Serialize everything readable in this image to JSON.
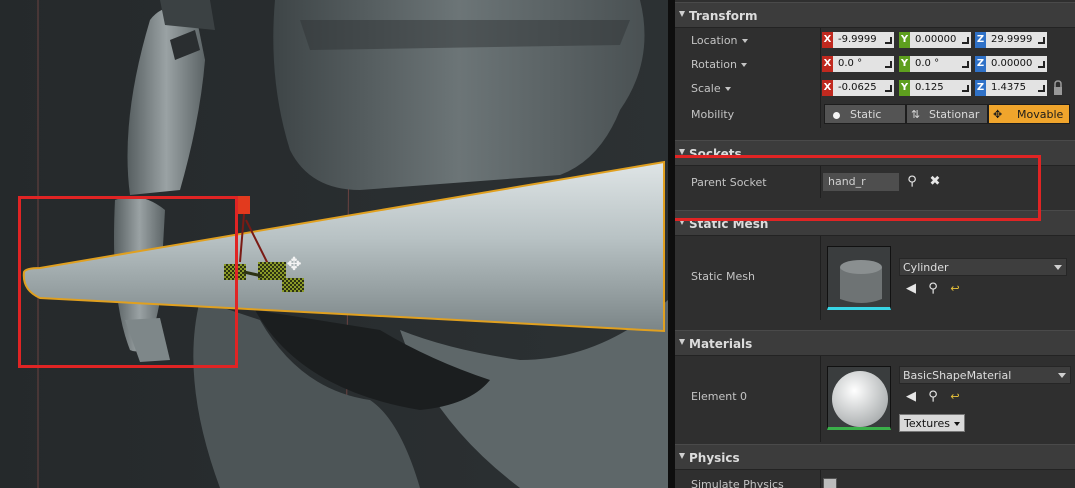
{
  "details": {
    "transform": {
      "title": "Transform",
      "location": {
        "label": "Location",
        "x": "-9.9999",
        "y": "0.00000",
        "z": "29.9999"
      },
      "rotation": {
        "label": "Rotation",
        "x": "0.0 °",
        "y": "0.0 °",
        "z": "0.00000"
      },
      "scale": {
        "label": "Scale",
        "x": "-0.0625",
        "y": "0.125",
        "z": "1.4375"
      },
      "axis_x": "X",
      "axis_y": "Y",
      "axis_z": "Z",
      "mobility": {
        "label": "Mobility",
        "options": [
          "Static",
          "Stationar",
          "Movable"
        ],
        "selected": "Movable"
      }
    },
    "sockets": {
      "title": "Sockets",
      "parent_socket_label": "Parent Socket",
      "parent_socket_value": "hand_r"
    },
    "static_mesh": {
      "title": "Static Mesh",
      "label": "Static Mesh",
      "value": "Cylinder"
    },
    "materials": {
      "title": "Materials",
      "element_label": "Element 0",
      "value": "BasicShapeMaterial",
      "textures_button": "Textures"
    },
    "physics": {
      "title": "Physics",
      "simulate_label": "Simulate Physics"
    }
  },
  "colors": {
    "highlight_box": "#e02424",
    "selection_outline": "#e0a020",
    "mobility_active": "#f0a52c",
    "axis_x": "#c0291f",
    "axis_y": "#5e9f1e",
    "axis_z": "#2f71c7"
  },
  "icons": [
    "move-gizmo-icon",
    "browse-arrow-icon",
    "search-icon",
    "clear-x-icon",
    "reset-to-default-icon",
    "lock-icon"
  ]
}
